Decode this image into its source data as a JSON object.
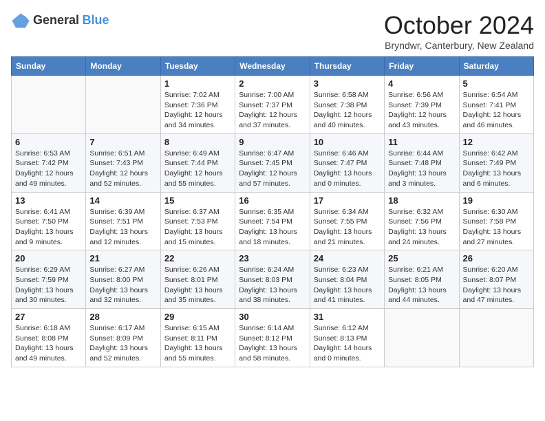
{
  "header": {
    "logo": {
      "general": "General",
      "blue": "Blue"
    },
    "title": "October 2024",
    "subtitle": "Bryndwr, Canterbury, New Zealand"
  },
  "calendar": {
    "days_of_week": [
      "Sunday",
      "Monday",
      "Tuesday",
      "Wednesday",
      "Thursday",
      "Friday",
      "Saturday"
    ],
    "weeks": [
      [
        {
          "day": "",
          "info": ""
        },
        {
          "day": "",
          "info": ""
        },
        {
          "day": "1",
          "info": "Sunrise: 7:02 AM\nSunset: 7:36 PM\nDaylight: 12 hours and 34 minutes."
        },
        {
          "day": "2",
          "info": "Sunrise: 7:00 AM\nSunset: 7:37 PM\nDaylight: 12 hours and 37 minutes."
        },
        {
          "day": "3",
          "info": "Sunrise: 6:58 AM\nSunset: 7:38 PM\nDaylight: 12 hours and 40 minutes."
        },
        {
          "day": "4",
          "info": "Sunrise: 6:56 AM\nSunset: 7:39 PM\nDaylight: 12 hours and 43 minutes."
        },
        {
          "day": "5",
          "info": "Sunrise: 6:54 AM\nSunset: 7:41 PM\nDaylight: 12 hours and 46 minutes."
        }
      ],
      [
        {
          "day": "6",
          "info": "Sunrise: 6:53 AM\nSunset: 7:42 PM\nDaylight: 12 hours and 49 minutes."
        },
        {
          "day": "7",
          "info": "Sunrise: 6:51 AM\nSunset: 7:43 PM\nDaylight: 12 hours and 52 minutes."
        },
        {
          "day": "8",
          "info": "Sunrise: 6:49 AM\nSunset: 7:44 PM\nDaylight: 12 hours and 55 minutes."
        },
        {
          "day": "9",
          "info": "Sunrise: 6:47 AM\nSunset: 7:45 PM\nDaylight: 12 hours and 57 minutes."
        },
        {
          "day": "10",
          "info": "Sunrise: 6:46 AM\nSunset: 7:47 PM\nDaylight: 13 hours and 0 minutes."
        },
        {
          "day": "11",
          "info": "Sunrise: 6:44 AM\nSunset: 7:48 PM\nDaylight: 13 hours and 3 minutes."
        },
        {
          "day": "12",
          "info": "Sunrise: 6:42 AM\nSunset: 7:49 PM\nDaylight: 13 hours and 6 minutes."
        }
      ],
      [
        {
          "day": "13",
          "info": "Sunrise: 6:41 AM\nSunset: 7:50 PM\nDaylight: 13 hours and 9 minutes."
        },
        {
          "day": "14",
          "info": "Sunrise: 6:39 AM\nSunset: 7:51 PM\nDaylight: 13 hours and 12 minutes."
        },
        {
          "day": "15",
          "info": "Sunrise: 6:37 AM\nSunset: 7:53 PM\nDaylight: 13 hours and 15 minutes."
        },
        {
          "day": "16",
          "info": "Sunrise: 6:35 AM\nSunset: 7:54 PM\nDaylight: 13 hours and 18 minutes."
        },
        {
          "day": "17",
          "info": "Sunrise: 6:34 AM\nSunset: 7:55 PM\nDaylight: 13 hours and 21 minutes."
        },
        {
          "day": "18",
          "info": "Sunrise: 6:32 AM\nSunset: 7:56 PM\nDaylight: 13 hours and 24 minutes."
        },
        {
          "day": "19",
          "info": "Sunrise: 6:30 AM\nSunset: 7:58 PM\nDaylight: 13 hours and 27 minutes."
        }
      ],
      [
        {
          "day": "20",
          "info": "Sunrise: 6:29 AM\nSunset: 7:59 PM\nDaylight: 13 hours and 30 minutes."
        },
        {
          "day": "21",
          "info": "Sunrise: 6:27 AM\nSunset: 8:00 PM\nDaylight: 13 hours and 32 minutes."
        },
        {
          "day": "22",
          "info": "Sunrise: 6:26 AM\nSunset: 8:01 PM\nDaylight: 13 hours and 35 minutes."
        },
        {
          "day": "23",
          "info": "Sunrise: 6:24 AM\nSunset: 8:03 PM\nDaylight: 13 hours and 38 minutes."
        },
        {
          "day": "24",
          "info": "Sunrise: 6:23 AM\nSunset: 8:04 PM\nDaylight: 13 hours and 41 minutes."
        },
        {
          "day": "25",
          "info": "Sunrise: 6:21 AM\nSunset: 8:05 PM\nDaylight: 13 hours and 44 minutes."
        },
        {
          "day": "26",
          "info": "Sunrise: 6:20 AM\nSunset: 8:07 PM\nDaylight: 13 hours and 47 minutes."
        }
      ],
      [
        {
          "day": "27",
          "info": "Sunrise: 6:18 AM\nSunset: 8:08 PM\nDaylight: 13 hours and 49 minutes."
        },
        {
          "day": "28",
          "info": "Sunrise: 6:17 AM\nSunset: 8:09 PM\nDaylight: 13 hours and 52 minutes."
        },
        {
          "day": "29",
          "info": "Sunrise: 6:15 AM\nSunset: 8:11 PM\nDaylight: 13 hours and 55 minutes."
        },
        {
          "day": "30",
          "info": "Sunrise: 6:14 AM\nSunset: 8:12 PM\nDaylight: 13 hours and 58 minutes."
        },
        {
          "day": "31",
          "info": "Sunrise: 6:12 AM\nSunset: 8:13 PM\nDaylight: 14 hours and 0 minutes."
        },
        {
          "day": "",
          "info": ""
        },
        {
          "day": "",
          "info": ""
        }
      ]
    ]
  }
}
